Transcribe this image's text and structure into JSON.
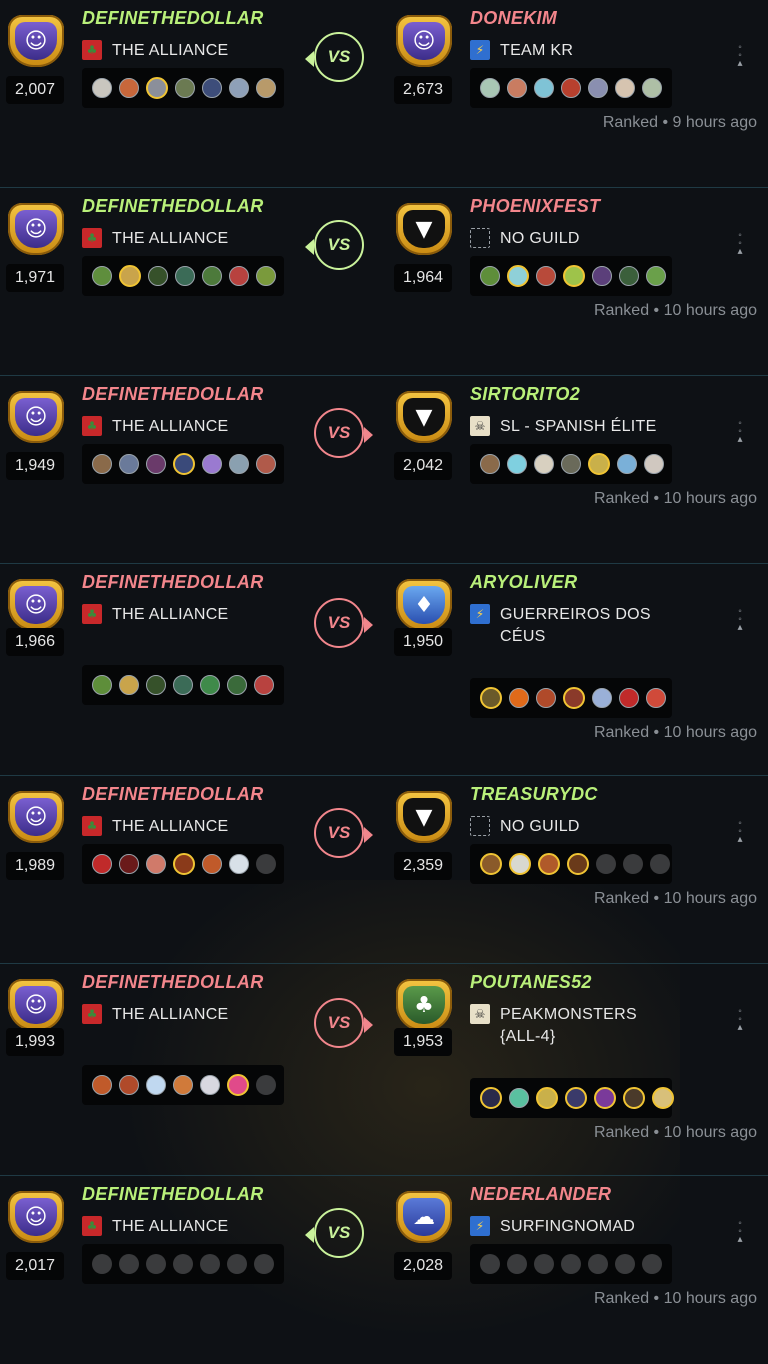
{
  "colors": {
    "win_name": "#b9f07a",
    "loss_name": "#f3868c",
    "win_vs": "#c9f29b",
    "loss_vs": "#f1868c",
    "gold_border": "#f0c434"
  },
  "matches": [
    {
      "result": "win",
      "vs_label": "VS",
      "meta": "Ranked • 9 hours ago",
      "left": {
        "name": "DEFINETHEDOLLAR",
        "guild": "THE ALLIANCE",
        "guild_icon": "tree-banner-icon",
        "rating": "2,007",
        "avatar": "wizard-avatar",
        "cards": [
          "#c9c6bf",
          "#c7673b",
          "#8b8f9a",
          "#6b7a52",
          "#3d4d7a",
          "#8ea0b8",
          "#b89a6a"
        ],
        "gold": [
          2
        ]
      },
      "right": {
        "name": "DONEKIM",
        "guild": "TEAM KR",
        "guild_icon": "lightning-banner-icon",
        "rating": "2,673",
        "avatar": "wizard-avatar",
        "cards": [
          "#a9c6b5",
          "#c97c61",
          "#7fc3d6",
          "#b8402e",
          "#8a8fb0",
          "#d6c4b0",
          "#aebfa6"
        ],
        "gold": []
      }
    },
    {
      "result": "win",
      "vs_label": "VS",
      "meta": "Ranked • 10 hours ago",
      "left": {
        "name": "DEFINETHEDOLLAR",
        "guild": "THE ALLIANCE",
        "guild_icon": "tree-banner-icon",
        "rating": "1,971",
        "avatar": "wizard-avatar",
        "cards": [
          "#5f8e3d",
          "#c9a44b",
          "#36512a",
          "#3b6b57",
          "#4d7a3b",
          "#b8423f",
          "#7a9a3c"
        ],
        "gold": [
          1
        ]
      },
      "right": {
        "name": "PHOENIXFEST",
        "guild": "NO GUILD",
        "guild_icon": "no-guild-icon",
        "rating": "1,964",
        "avatar": "fanged-avatar",
        "cards": [
          "#5e8e3a",
          "#8fd0d8",
          "#b84a3a",
          "#9ec34a",
          "#5b3f7a",
          "#3b5f3b",
          "#6aa04a"
        ],
        "gold": [
          1,
          3
        ]
      }
    },
    {
      "result": "loss",
      "vs_label": "VS",
      "meta": "Ranked • 10 hours ago",
      "left": {
        "name": "DEFINETHEDOLLAR",
        "guild": "THE ALLIANCE",
        "guild_icon": "tree-banner-icon",
        "rating": "1,949",
        "avatar": "wizard-avatar",
        "cards": [
          "#8a6a4a",
          "#6a7a9a",
          "#6a3a6a",
          "#3a4a7a",
          "#9a7ad0",
          "#8aa0b0",
          "#b05a4a"
        ],
        "gold": [
          3
        ]
      },
      "right": {
        "name": "SIRTORITO2",
        "guild": "SL - SPANISH ÉLITE",
        "guild_icon": "skull-banner-icon",
        "rating": "2,042",
        "avatar": "fanged-avatar",
        "cards": [
          "#8a6a4a",
          "#7fd0e0",
          "#d8d0c0",
          "#6a6a5a",
          "#c9b04a",
          "#7ab0d8",
          "#d0c8c0"
        ],
        "gold": [
          4
        ]
      }
    },
    {
      "result": "loss",
      "vs_label": "VS",
      "meta": "Ranked • 10 hours ago",
      "left": {
        "name": "DEFINETHEDOLLAR",
        "guild": "THE ALLIANCE",
        "guild_icon": "tree-banner-icon",
        "rating": "1,966",
        "avatar": "wizard-avatar",
        "cards": [
          "#5e8e3a",
          "#c9a44b",
          "#36512a",
          "#3b6b57",
          "#3f8a4a",
          "#3a6a3a",
          "#b8423f"
        ],
        "gold": []
      },
      "right": {
        "name": "ARYOLIVER",
        "guild": "GUERREIROS DOS CÉUS",
        "guild_icon": "lightning-banner-icon",
        "rating": "1,950",
        "avatar": "dragon-avatar",
        "cards": [
          "#6a5a2a",
          "#e06a1a",
          "#b04a2a",
          "#8a3a2a",
          "#9ab0d8",
          "#c02a2a",
          "#d04a3a"
        ],
        "gold": [
          0,
          3
        ]
      }
    },
    {
      "result": "loss",
      "vs_label": "VS",
      "meta": "Ranked • 10 hours ago",
      "left": {
        "name": "DEFINETHEDOLLAR",
        "guild": "THE ALLIANCE",
        "guild_icon": "tree-banner-icon",
        "rating": "1,989",
        "avatar": "wizard-avatar",
        "cards": [
          "#c02a2a",
          "#6a1a1a",
          "#d07a6a",
          "#8a3a1a",
          "#c05a2a",
          "#d8e0e8",
          "empty"
        ],
        "gold": [
          3
        ]
      },
      "right": {
        "name": "TREASURYDC",
        "guild": "NO GUILD",
        "guild_icon": "no-guild-icon",
        "rating": "2,359",
        "avatar": "fanged-avatar",
        "cards": [
          "#8a5a2a",
          "#d8d8d0",
          "#b05a2a",
          "#6a3a1a",
          "empty",
          "empty",
          "empty"
        ],
        "gold": [
          0,
          1,
          2,
          3
        ]
      }
    },
    {
      "result": "loss",
      "vs_label": "VS",
      "meta": "Ranked • 10 hours ago",
      "left": {
        "name": "DEFINETHEDOLLAR",
        "guild": "THE ALLIANCE",
        "guild_icon": "tree-banner-icon",
        "rating": "1,993",
        "avatar": "wizard-avatar",
        "cards": [
          "#c05a2a",
          "#b04a2a",
          "#c0d8f0",
          "#d07a3a",
          "#d8d8e0",
          "#e04a8a",
          "empty"
        ],
        "gold": [
          5
        ]
      },
      "right": {
        "name": "POUTANES52",
        "guild": "PEAKMONSTERS {ALL-4}",
        "guild_icon": "skull-banner-icon",
        "rating": "1,953",
        "avatar": "goblin-avatar",
        "cards": [
          "#2a2a4a",
          "#5ac0a0",
          "#c9b04a",
          "#3a3a6a",
          "#7a3a9a",
          "#4a3a2a",
          "#d8c07a"
        ],
        "gold": [
          0,
          2,
          3,
          4,
          5,
          6
        ]
      }
    },
    {
      "result": "win",
      "vs_label": "VS",
      "meta": "Ranked • 10 hours ago",
      "left": {
        "name": "DEFINETHEDOLLAR",
        "guild": "THE ALLIANCE",
        "guild_icon": "tree-banner-icon",
        "rating": "2,017",
        "avatar": "wizard-avatar",
        "cards": [
          "empty",
          "empty",
          "empty",
          "empty",
          "empty",
          "empty",
          "empty"
        ],
        "gold": []
      },
      "right": {
        "name": "NEDERLANDER",
        "guild": "SURFINGNOMAD",
        "guild_icon": "lightning-banner-icon",
        "rating": "2,028",
        "avatar": "ghost-avatar",
        "cards": [
          "empty",
          "empty",
          "empty",
          "empty",
          "empty",
          "empty",
          "empty"
        ],
        "gold": []
      }
    }
  ]
}
